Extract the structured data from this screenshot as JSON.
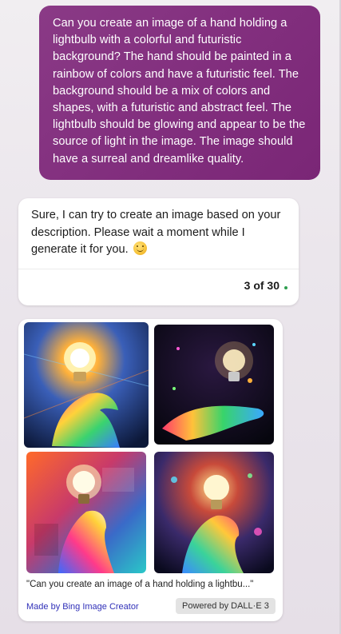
{
  "conversation": {
    "user_message": "Can you create an image of a hand holding a lightbulb with a colorful and futuristic background? The hand should be painted in a rainbow of colors and have a futuristic feel. The background should be a mix of colors and shapes, with a futuristic and abstract feel. The lightbulb should be glowing and appear to be the source of light in the image. The image should have a surreal and dreamlike quality.",
    "bot_reply": "Sure, I can try to create an image based on your description. Please wait a moment while I generate it for you.",
    "bot_reply_emoji": "smiling-face-icon",
    "turn_counter": "3 of 30",
    "turn_indicator_color": "#2e9e4f"
  },
  "image_result": {
    "images": [
      {
        "name": "generated-image-1"
      },
      {
        "name": "generated-image-2"
      },
      {
        "name": "generated-image-3"
      },
      {
        "name": "generated-image-4"
      }
    ],
    "caption": "\"Can you create an image of a hand holding a lightbu...\"",
    "made_by_link": "Made by Bing Image Creator",
    "powered_by_badge": "Powered by DALL·E 3"
  },
  "colors": {
    "user_bubble": "#83307f",
    "link": "#3030b8"
  }
}
